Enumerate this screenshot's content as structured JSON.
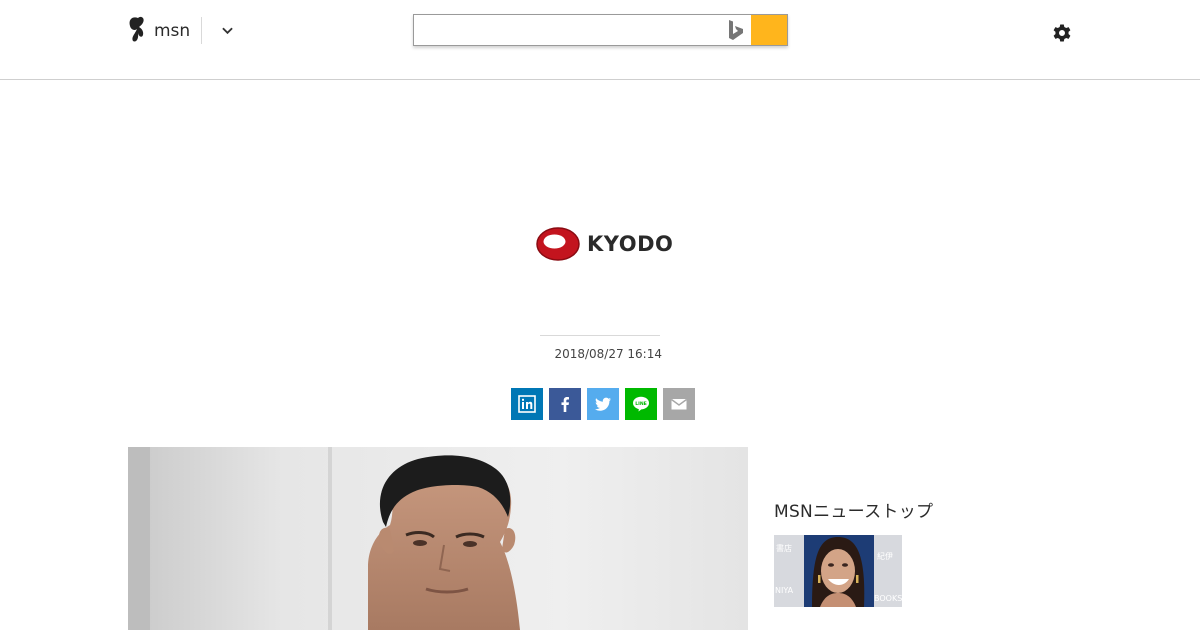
{
  "header": {
    "logo_text": "msn",
    "search": {
      "value": "",
      "placeholder": ""
    },
    "colors": {
      "search_button": "#ffb51c",
      "bing_logo": "#767676"
    }
  },
  "article": {
    "provider": {
      "name": "KYODO",
      "logo_color": "#c3141e"
    },
    "timestamp": "2018/08/27 16:14",
    "share": [
      {
        "network": "linkedin",
        "icon": "linkedin-icon",
        "color": "#0077b5"
      },
      {
        "network": "facebook",
        "icon": "facebook-icon",
        "color": "#3b5998"
      },
      {
        "network": "twitter",
        "icon": "twitter-icon",
        "color": "#55acee"
      },
      {
        "network": "line",
        "icon": "line-icon",
        "color": "#00b900"
      },
      {
        "network": "email",
        "icon": "mail-icon",
        "color": "#a7a7a7"
      }
    ]
  },
  "sidebar": {
    "heading": "MSNニューストップ",
    "thumbnail": {
      "text_left_top": "書店",
      "text_left_bottom": "NIYA",
      "text_right_top": "紀伊",
      "text_right_bottom": "BOOKS K"
    }
  }
}
